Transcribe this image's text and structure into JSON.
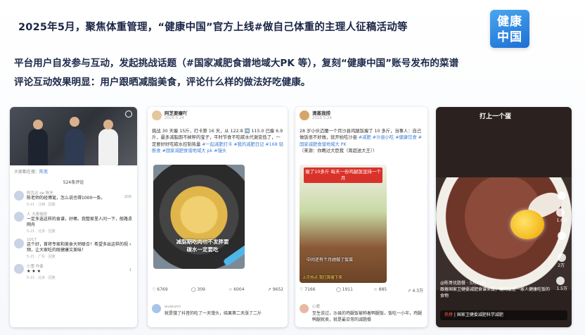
{
  "header": {
    "headline": "2025年5月，聚焦体重管理，“健康中国”官方上线#做自己体重的主理人征稿活动等",
    "logo_line1": "健康",
    "logo_line2": "中国"
  },
  "intro": {
    "line1": "平台用户自发参与互动，发起挑战话题（#国家减肥食谱地域大PK 等），复刻“健康中国”账号发布的菜谱",
    "line2": "评论互动效果明显：用户跟晒减脂美食，评论什么样的做法好吃健康。"
  },
  "card1": {
    "panel_top_prefix": "大家都在搜：",
    "panel_top_link": "陈宽",
    "comment_count": "524条评论",
    "comments": [
      {
        "user": "阿瓦达 de 陈先",
        "text": "陈老师的经博诞，怎么说也得1000一条。",
        "meta": "5-21 · 江西 · 回复",
        "likes": "206"
      },
      {
        "user": "人 大奇瑞安",
        "text": "一定多选这样的食谱，好棒。我整家里人问一下，般路点网舟",
        "meta": "5-21 · 北京 · 回复",
        "likes": "0"
      },
      {
        "user": "1017",
        "text": "这个好，首将专家和美食大师联合！希望多出这样的视频，让大家吃的既健康又美味！",
        "meta": "5-21 · 广东 · 回复",
        "likes": "4"
      },
      {
        "user": "小雪 作者",
        "text": "",
        "meta": "5-21 · 北京 · 回复",
        "likes": "1"
      }
    ]
  },
  "card2": {
    "user": "阿芝要瘦吖",
    "date": "2025.5.24",
    "text_plain": "挑战 30 天瘦 15斤，打卡第 16 天，从 122.8 ➡️ 115.0 已瘦 6.9 斤，最多减脂期不掉秤的宝子，平时节食不吃碳水代谢变低了，一定要好好吃碳水控制热量",
    "tags": "#一起减肥打卡 #我的减肥日记 #168 轻断食 #国家减肥食谱地域大 pk #馒头",
    "image_caption": "减脂期吃肉也不发胖要碳水一定要吃",
    "stats": {
      "likes": "6769",
      "comments": "309",
      "favorites": "6004",
      "shares": "9652"
    },
    "commenter": "wuwumi",
    "comment": "就是饿了抖音的吃了一天馒头，结果第二天涨了二斤",
    "comment_likes": "16"
  },
  "card3": {
    "user": "清蒸我捞",
    "date": "2025.5.24",
    "text_plain": "28 岁小伙迈腰一个月沙县鸡腿饭瘦了 10 多斤，当事人：自己做饭很不好做，就开始吃沙县",
    "tags": "#减肥 #沙县小吃 #健康饮食 #国家减肥食谱地域大 PK",
    "text_tail": "（来源：你瞧过大臣我（周超送大王））",
    "banner": "瘦了10多斤 每天一份鸡腿饭坚持一个月",
    "image_caption": "中间还有个月她做了饭菜",
    "sub_caption": "上月热点 我打算瘦下来",
    "stats": {
      "likes": "7166",
      "comments": "1911",
      "favorites": "885",
      "shares": "4.3万"
    },
    "commenter": "心暖",
    "comment": "至生说过，沙县的鸡腿饭被称着鸭腿饭，饭吃一小半，鸡腿鸭腿就卖，就是最日常的减脂餐",
    "comment_likes": "3491"
  },
  "card4": {
    "title": "打上一个蛋",
    "side_counts": [
      "1.6万",
      "5",
      "2万",
      "1.5万",
      "2万"
    ],
    "foot_user": "@陈哥优脂餐",
    "foot_date": "5月15日",
    "foot_text": "跟着国家卫健委减肥食谱来做，瘦肉饭是一家人健康吃饭的食物",
    "hot_label": "热榜",
    "bar_text": "国家卫健委减肥科学减肥"
  }
}
